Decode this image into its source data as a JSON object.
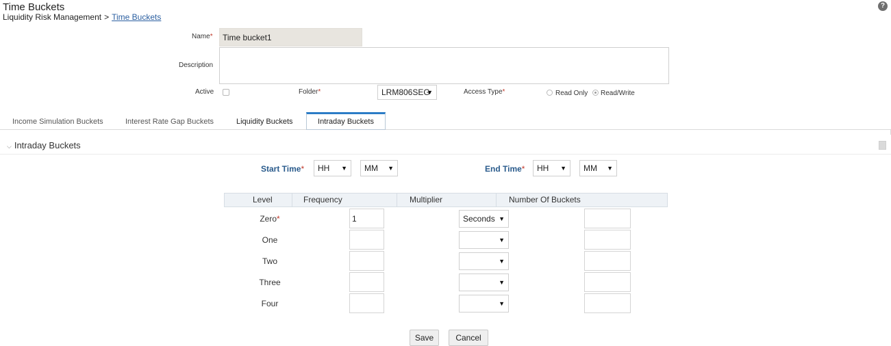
{
  "header": {
    "title": "Time Buckets",
    "breadcrumb_root": "Liquidity Risk Management",
    "breadcrumb_sep": ">",
    "breadcrumb_current": "Time Buckets",
    "help_icon": "question-mark-icon",
    "help_glyph": "?"
  },
  "form": {
    "name_label": "Name",
    "name_value": "Time bucket1",
    "description_label": "Description",
    "description_value": "",
    "active_label": "Active",
    "active_checked": false,
    "folder_label": "Folder",
    "folder_value": "LRM806SEG",
    "access_type_label": "Access Type",
    "access_options": [
      "Read Only",
      "Read/Write"
    ],
    "access_selected": "Read/Write",
    "required_marker": "*"
  },
  "tabs": {
    "items": [
      "Income Simulation Buckets",
      "Interest Rate Gap Buckets",
      "Liquidity Buckets",
      "Intraday Buckets"
    ],
    "active": "Intraday Buckets"
  },
  "section": {
    "title": "Intraday Buckets",
    "collapse_icon": "chevron-down-icon",
    "chevron_glyph": "⌵"
  },
  "times": {
    "start_label": "Start Time",
    "start_hh": "HH",
    "start_mm": "MM",
    "end_label": "End Time",
    "end_hh": "HH",
    "end_mm": "MM"
  },
  "grid": {
    "headers": [
      "Level",
      "Frequency",
      "Multiplier",
      "Number Of Buckets"
    ],
    "rows": [
      {
        "level": "Zero",
        "required": true,
        "multiplier": "1",
        "frequency": "Seconds",
        "buckets": ""
      },
      {
        "level": "One",
        "required": false,
        "multiplier": "",
        "frequency": "",
        "buckets": ""
      },
      {
        "level": "Two",
        "required": false,
        "multiplier": "",
        "frequency": "",
        "buckets": ""
      },
      {
        "level": "Three",
        "required": false,
        "multiplier": "",
        "frequency": "",
        "buckets": ""
      },
      {
        "level": "Four",
        "required": false,
        "multiplier": "",
        "frequency": "",
        "buckets": ""
      }
    ]
  },
  "buttons": {
    "save": "Save",
    "cancel": "Cancel"
  },
  "glyphs": {
    "dropdown_arrow": "▼"
  },
  "colors": {
    "link": "#2a5ea0",
    "active_tab_accent": "#2b7cc6",
    "time_label": "#2a5b8c",
    "required": "#c0392b"
  }
}
